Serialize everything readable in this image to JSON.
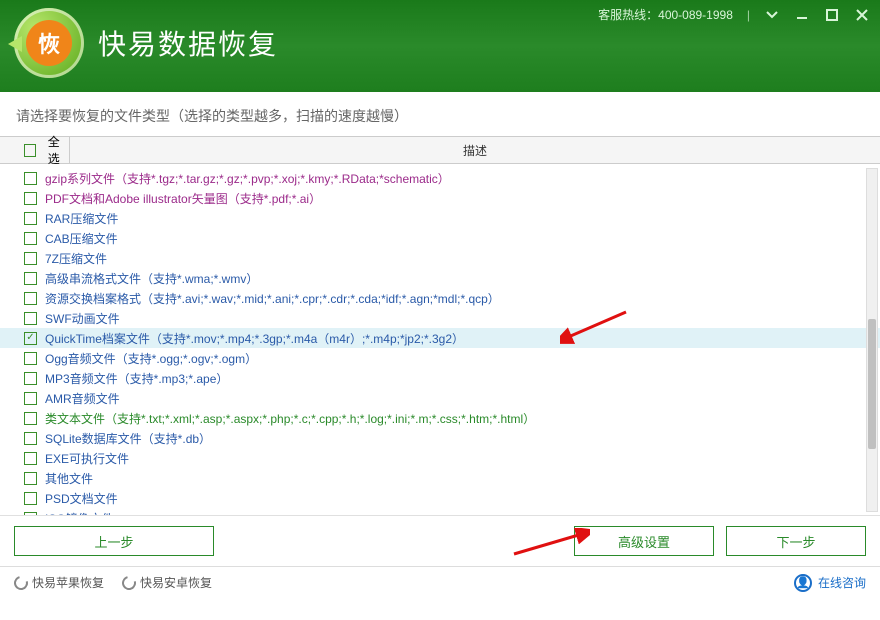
{
  "titlebar": {
    "hotline_label": "客服热线：",
    "hotline_number": "400-089-1998",
    "app_title": "快易数据恢复",
    "logo_char": "恢"
  },
  "prompt": "请选择要恢复的文件类型（选择的类型越多，扫描的速度越慢）",
  "table": {
    "select_all": "全选",
    "desc_header": "描述"
  },
  "rows": [
    {
      "label": "gzip系列文件（支持*.tgz;*.tar.gz;*.gz;*.pvp;*.xoj;*.kmy;*.RData;*schematic）",
      "color": "purple",
      "checked": false
    },
    {
      "label": "PDF文档和Adobe illustrator矢量图（支持*.pdf;*.ai）",
      "color": "purple",
      "checked": false
    },
    {
      "label": "RAR压缩文件",
      "color": "blue",
      "checked": false
    },
    {
      "label": "CAB压缩文件",
      "color": "blue",
      "checked": false
    },
    {
      "label": "7Z压缩文件",
      "color": "blue",
      "checked": false
    },
    {
      "label": "高级串流格式文件（支持*.wma;*.wmv）",
      "color": "blue",
      "checked": false
    },
    {
      "label": "资源交换档案格式（支持*.avi;*.wav;*.mid;*.ani;*.cpr;*.cdr;*.cda;*idf;*.agn;*mdl;*.qcp）",
      "color": "blue",
      "checked": false
    },
    {
      "label": "SWF动画文件",
      "color": "blue",
      "checked": false
    },
    {
      "label": "QuickTime档案文件（支持*.mov;*.mp4;*.3gp;*.m4a（m4r）;*.m4p;*jp2;*.3g2）",
      "color": "blue",
      "checked": true,
      "highlight": true
    },
    {
      "label": "Ogg音频文件（支持*.ogg;*.ogv;*.ogm）",
      "color": "blue",
      "checked": false
    },
    {
      "label": "MP3音频文件（支持*.mp3;*.ape）",
      "color": "blue",
      "checked": false
    },
    {
      "label": "AMR音频文件",
      "color": "blue",
      "checked": false
    },
    {
      "label": "类文本文件（支持*.txt;*.xml;*.asp;*.aspx;*.php;*.c;*.cpp;*.h;*.log;*.ini;*.m;*.css;*.htm;*.html）",
      "color": "green",
      "checked": false
    },
    {
      "label": "SQLite数据库文件（支持*.db）",
      "color": "blue",
      "checked": false
    },
    {
      "label": "EXE可执行文件",
      "color": "blue",
      "checked": false
    },
    {
      "label": "其他文件",
      "color": "blue",
      "checked": false
    },
    {
      "label": "PSD文档文件",
      "color": "blue",
      "checked": false
    },
    {
      "label": "ISO镜像文件",
      "color": "blue",
      "checked": false
    }
  ],
  "buttons": {
    "prev": "上一步",
    "advanced": "高级设置",
    "next": "下一步"
  },
  "footer": {
    "apple": "快易苹果恢复",
    "android": "快易安卓恢复",
    "online": "在线咨询"
  }
}
